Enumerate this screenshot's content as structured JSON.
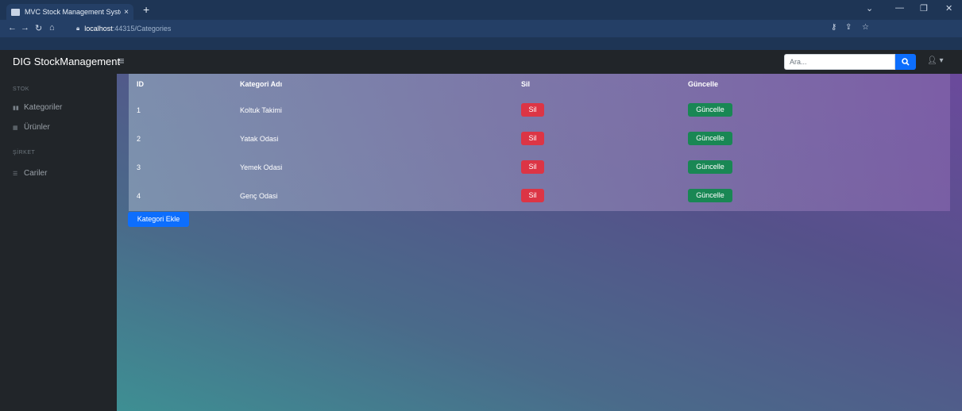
{
  "browser": {
    "tab_title": "MVC Stock Management System",
    "tab_close": "×",
    "new_tab": "+",
    "url_host": "localhost",
    "url_path": ":44315/Categories"
  },
  "navbar": {
    "brand": "DIG StockManagement",
    "menu_icon": "≡",
    "search_placeholder": "Ara...",
    "user_caret": "▾"
  },
  "sidebar": {
    "sections": [
      {
        "heading": "STOK",
        "items": [
          {
            "label": "Kategoriler",
            "icon": "bar-chart-icon"
          },
          {
            "label": "Ürünler",
            "icon": "table-icon"
          }
        ]
      },
      {
        "heading": "ŞİRKET",
        "items": [
          {
            "label": "Cariler",
            "icon": "list-icon"
          }
        ]
      }
    ]
  },
  "table": {
    "headers": [
      "ID",
      "Kategori Adı",
      "Sil",
      "Güncelle"
    ],
    "rows": [
      {
        "id": "1",
        "name": "Koltuk Takimi",
        "delete": "Sil",
        "update": "Güncelle"
      },
      {
        "id": "2",
        "name": "Yatak Odasi",
        "delete": "Sil",
        "update": "Güncelle"
      },
      {
        "id": "3",
        "name": "Yemek Odasi",
        "delete": "Sil",
        "update": "Güncelle"
      },
      {
        "id": "4",
        "name": "Genç Odasi",
        "delete": "Sil",
        "update": "Güncelle"
      }
    ]
  },
  "actions": {
    "add_category": "Kategori Ekle"
  },
  "colors": {
    "danger": "#dc3545",
    "success": "#198754",
    "primary": "#0d6efd",
    "navbar_bg": "#212529"
  }
}
